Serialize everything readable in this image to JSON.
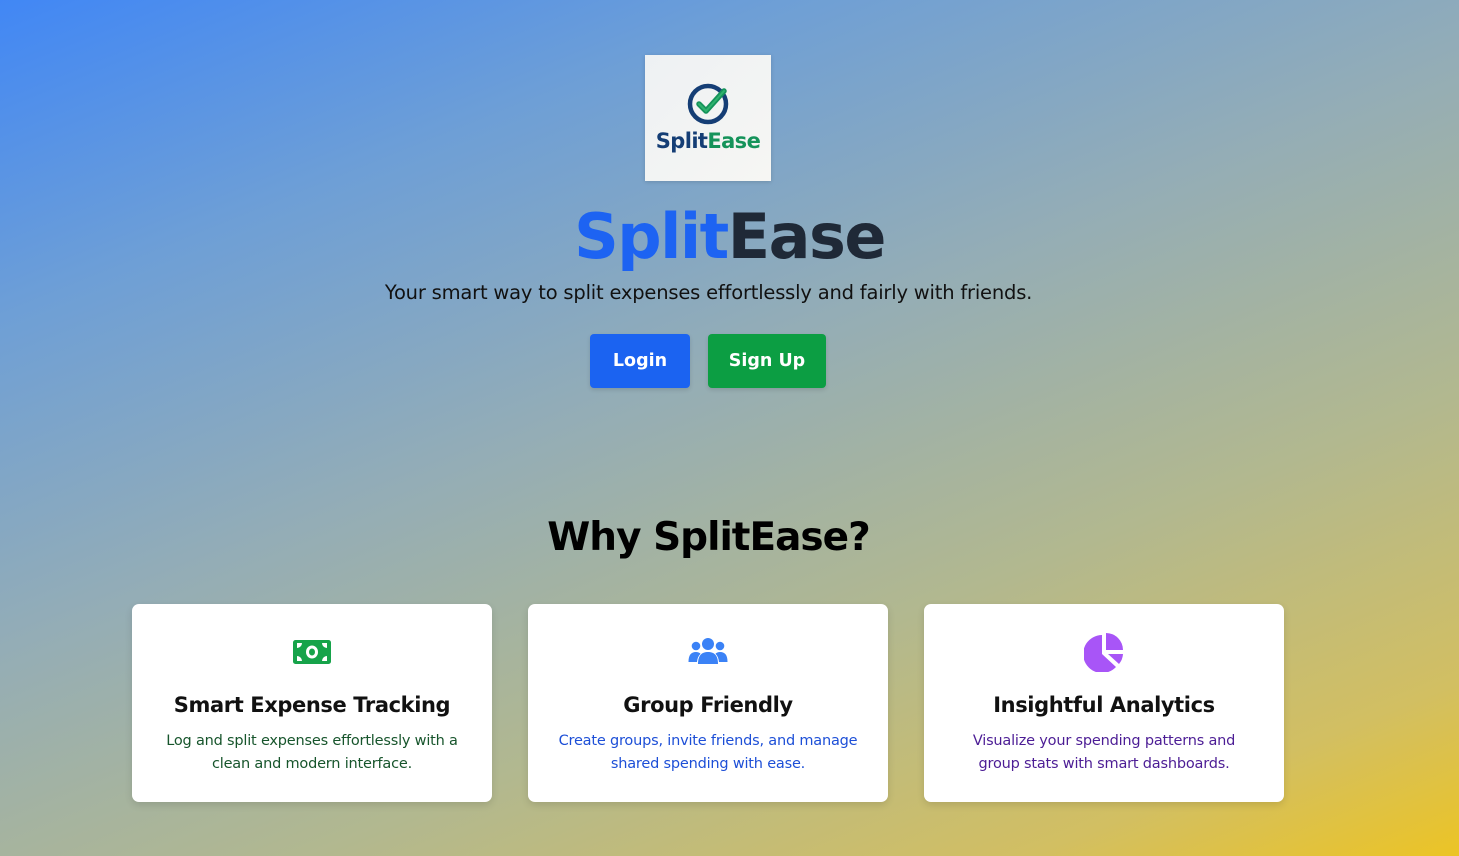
{
  "logo": {
    "word_part1": "Split",
    "word_part2": "Ease",
    "icon": "check-circle-icon",
    "colors": {
      "dark_blue": "#153e75",
      "green": "#15935a"
    }
  },
  "hero": {
    "title_part1": "Split",
    "title_part2": "Ease",
    "tagline": "Your smart way to split expenses effortlessly and fairly with friends."
  },
  "buttons": {
    "login": "Login",
    "signup": "Sign Up"
  },
  "features": {
    "title": "Why SplitEase?",
    "items": [
      {
        "icon": "money-bill-icon",
        "icon_color": "#16a34a",
        "title": "Smart Expense Tracking",
        "description": "Log and split expenses effortlessly with a clean and modern interface."
      },
      {
        "icon": "users-group-icon",
        "icon_color": "#3b82f6",
        "title": "Group Friendly",
        "description": "Create groups, invite friends, and manage shared spending with ease."
      },
      {
        "icon": "chart-pie-icon",
        "icon_color": "#a855f7",
        "title": "Insightful Analytics",
        "description": "Visualize your spending patterns and group stats with smart dashboards."
      }
    ]
  },
  "colors": {
    "primary_blue": "#1b63f1",
    "primary_green": "#0c9e43",
    "title_dark": "#1f2937"
  }
}
